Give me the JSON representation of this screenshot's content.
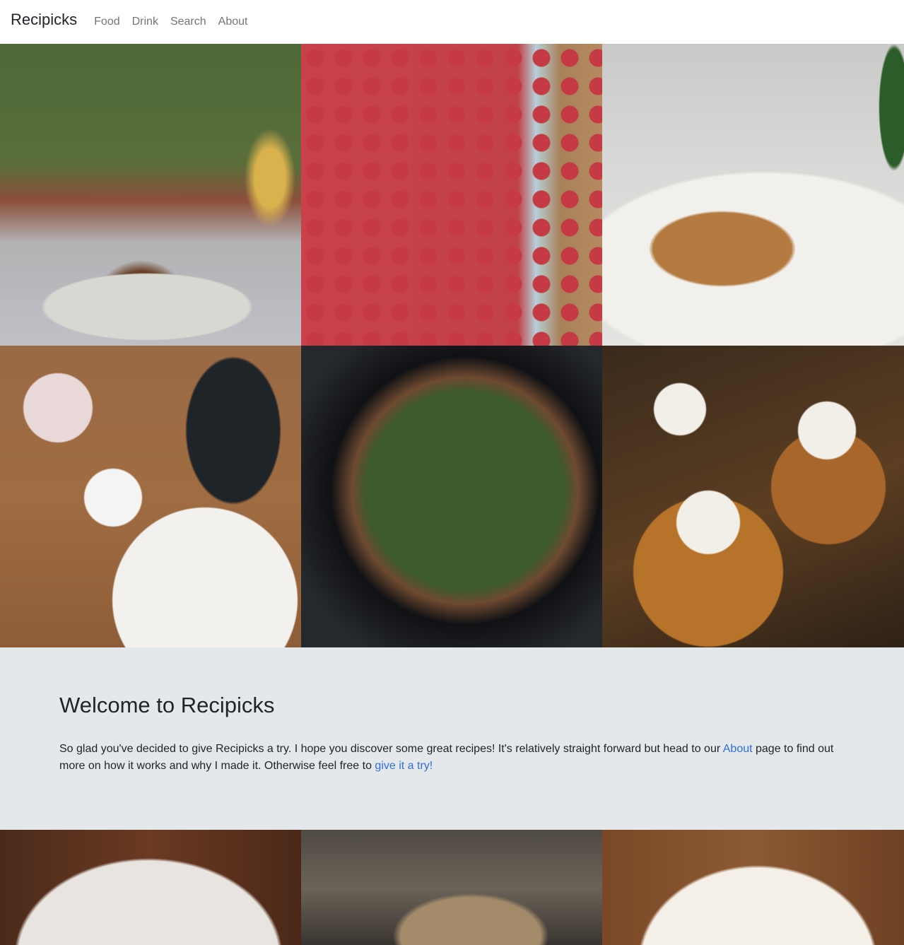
{
  "navbar": {
    "brand": "Recipicks",
    "links": [
      "Food",
      "Drink",
      "Search",
      "About"
    ]
  },
  "top_gallery": [
    {
      "alt": "plated meat dish with wine glass"
    },
    {
      "alt": "strawberry tart"
    },
    {
      "alt": "burger with potato wedges"
    },
    {
      "alt": "tea and avocado toast"
    },
    {
      "alt": "stir fry in pan"
    },
    {
      "alt": "cream topped pastries"
    }
  ],
  "hero": {
    "title": "Welcome to Recipicks",
    "text_before_about": "So glad you've decided to give Recipicks a try. I hope you discover some great recipes! It's relatively straight forward but head to our ",
    "about_link": "About",
    "text_after_about": " page to find out more on how it works and why I made it. Otherwise feel free to ",
    "try_link": "give it a try!"
  },
  "bottom_gallery": [
    {
      "alt": "dessert slice on plate"
    },
    {
      "alt": "blurred cafe scene"
    },
    {
      "alt": "noodle bowl with chopsticks"
    }
  ]
}
